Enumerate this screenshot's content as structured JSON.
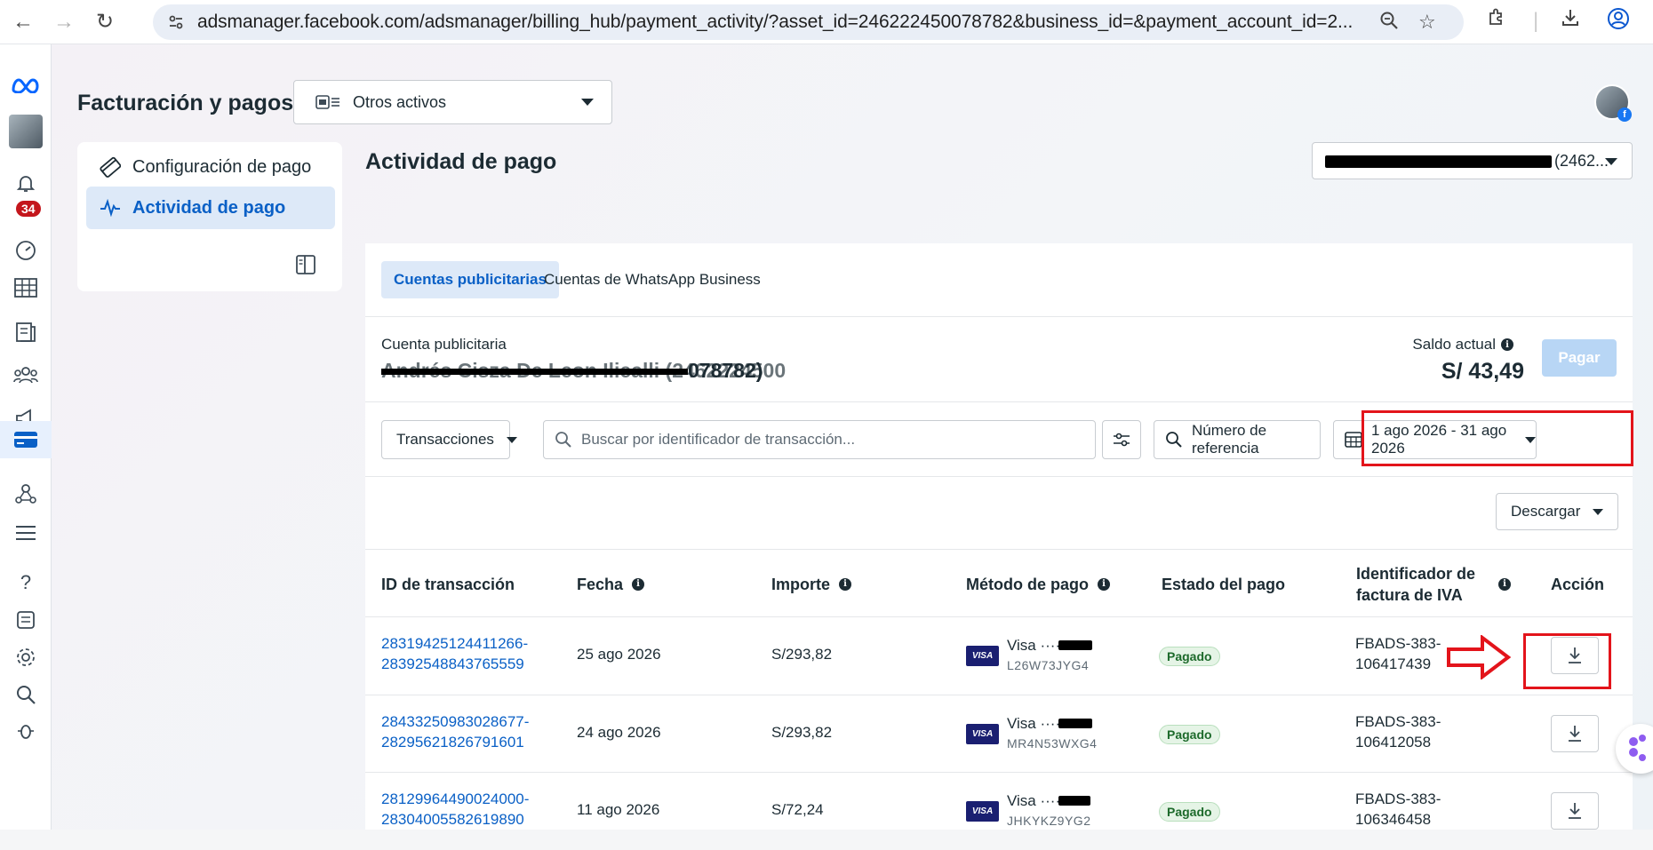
{
  "browser": {
    "url": "adsmanager.facebook.com/adsmanager/billing_hub/payment_activity/?asset_id=246222450078782&business_id=&payment_account_id=2..."
  },
  "rail": {
    "notification_count": "34"
  },
  "header": {
    "title": "Facturación y pagos",
    "asset_selector": "Otros activos"
  },
  "sidebar": {
    "items": [
      {
        "label": "Configuración de pago",
        "icon": "credit-card-icon"
      },
      {
        "label": "Actividad de pago",
        "icon": "activity-pulse-icon"
      }
    ]
  },
  "main": {
    "section_title": "Actividad de pago",
    "account_selector_suffix": "(2462...",
    "tabs": [
      {
        "label": "Cuentas publicitarias",
        "active": true
      },
      {
        "label": "Cuentas de WhatsApp Business",
        "active": false
      }
    ],
    "account": {
      "label": "Cuenta publicitaria",
      "name_visible_suffix": "078782)",
      "balance_label": "Saldo actual",
      "balance_value": "S/ 43,49",
      "pay_button": "Pagar"
    },
    "filters": {
      "type": "Transacciones",
      "search_placeholder": "Buscar por identificador de transacción...",
      "reference": "Número de referencia",
      "date_range": "1 ago 2026 - 31 ago 2026",
      "download": "Descargar"
    },
    "table": {
      "headers": [
        "ID de transacción",
        "Fecha",
        "Importe",
        "Método de pago",
        "Estado del pago",
        "Identificador de factura de IVA",
        "Acción"
      ],
      "rows": [
        {
          "id_line1": "28319425124411266-",
          "id_line2": "28392548843765559",
          "date": "25 ago 2026",
          "amount": "S/293,82",
          "method": "Visa ····",
          "method_code": "L26W73JYG4",
          "status": "Pagado",
          "invoice_line1": "FBADS-383-",
          "invoice_line2": "106417439"
        },
        {
          "id_line1": "28433250983028677-",
          "id_line2": "28295621826791601",
          "date": "24 ago 2026",
          "amount": "S/293,82",
          "method": "Visa ····",
          "method_code": "MR4N53WXG4",
          "status": "Pagado",
          "invoice_line1": "FBADS-383-",
          "invoice_line2": "106412058"
        },
        {
          "id_line1": "28129964490024000-",
          "id_line2": "28304005582619890",
          "date": "11 ago 2026",
          "amount": "S/72,24",
          "method": "Visa ····",
          "method_code": "JHKYKZ9YG2",
          "status": "Pagado",
          "invoice_line1": "FBADS-383-",
          "invoice_line2": "106346458"
        }
      ]
    }
  },
  "colors": {
    "accent": "#0a60c6",
    "highlight_red": "#e3141b",
    "status_green": "#1d6a2b"
  }
}
